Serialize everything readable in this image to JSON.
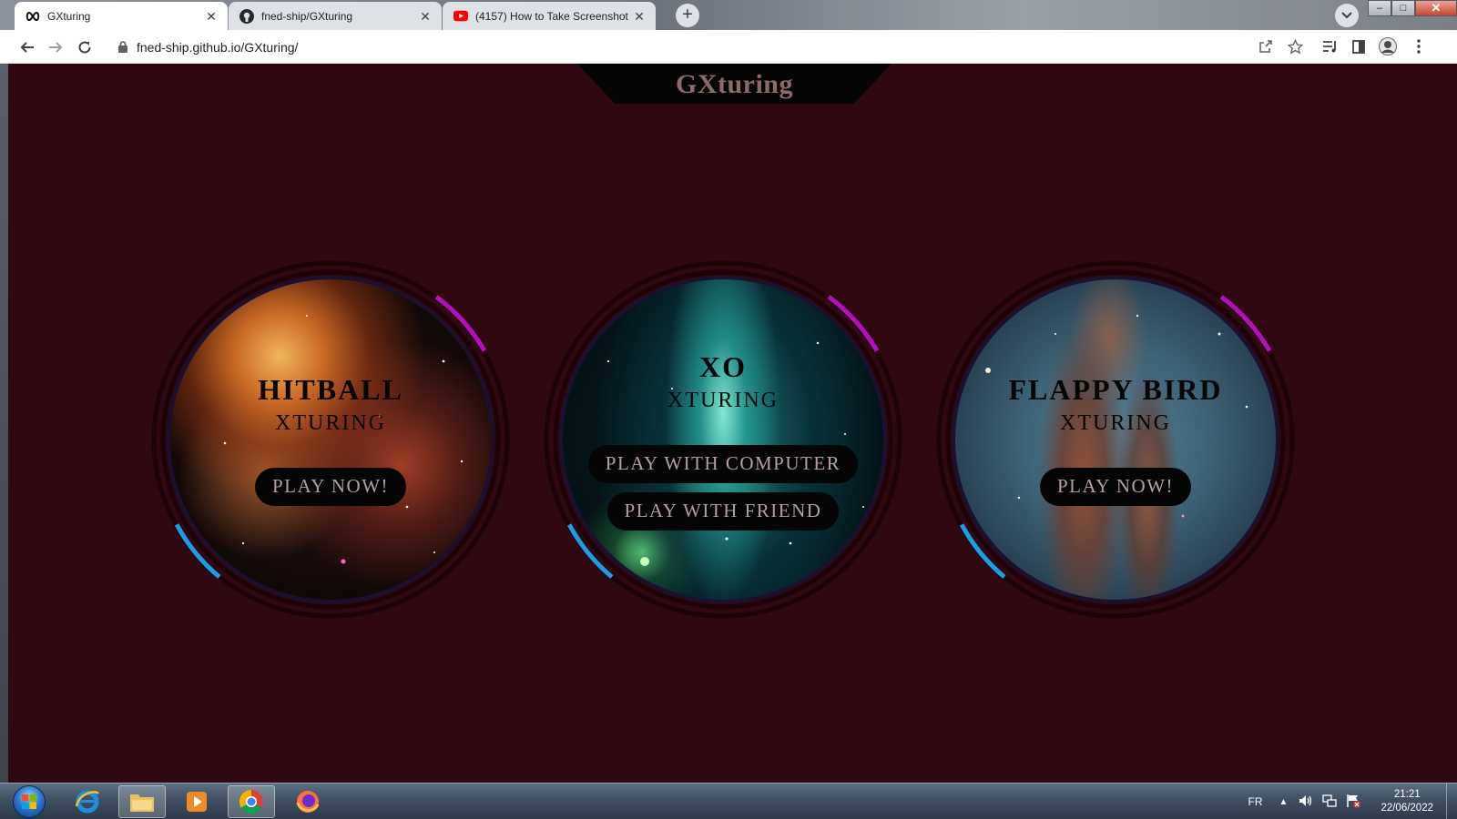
{
  "browser": {
    "tabs": [
      {
        "title": "GXturing",
        "active": true
      },
      {
        "title": "fned-ship/GXturing",
        "active": false
      },
      {
        "title": "(4157) How to Take Screenshot in",
        "active": false
      }
    ],
    "new_tab_label": "+",
    "address": "fned-ship.github.io/GXturing/",
    "window_controls": {
      "minimize": "–",
      "maximize": "□",
      "close": "✕"
    }
  },
  "site": {
    "title": "GXturing",
    "games": [
      {
        "title": "HITBALL",
        "subtitle": "XTURING",
        "buttons": [
          "PLAY NOW!"
        ]
      },
      {
        "title": "XO",
        "subtitle": "XTURING",
        "buttons": [
          "PLAY WITH COMPUTER",
          "PLAY WITH FRIEND"
        ]
      },
      {
        "title": "FLAPPY BIRD",
        "subtitle": "XTURING",
        "buttons": [
          "PLAY NOW!"
        ]
      }
    ]
  },
  "taskbar": {
    "language": "FR",
    "time": "21:21",
    "date": "22/06/2022"
  },
  "colors": {
    "page_bg": "#300811",
    "ring_outer": "#1d0308",
    "arc_magenta": "#b40fbf",
    "arc_blue": "#1b9ee6",
    "title_text": "#8c6a6a",
    "button_bg": "#050505",
    "button_text": "#b5a0a0"
  },
  "icons": {
    "tab1": "infinity-icon",
    "tab2": "github-icon",
    "tab3": "youtube-icon",
    "back": "arrow-left-icon",
    "forward": "arrow-right-icon",
    "reload": "reload-icon",
    "lock": "lock-icon",
    "share": "share-icon",
    "bookmark": "star-icon",
    "reading_list": "reading-list-icon",
    "side_panel": "side-panel-icon",
    "profile": "avatar-icon",
    "menu": "kebab-menu-icon"
  }
}
